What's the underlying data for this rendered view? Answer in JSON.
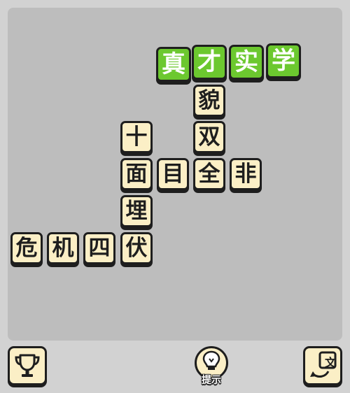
{
  "tiles": {
    "green": [
      "真",
      "才",
      "实",
      "学"
    ],
    "col_right": [
      "貌",
      "双"
    ],
    "row_mid": [
      "面",
      "目",
      "全",
      "非"
    ],
    "col_left": [
      "十",
      "埋"
    ],
    "row_bottom": [
      "危",
      "机",
      "四",
      "伏"
    ]
  },
  "buttons": {
    "hint_label": "提示",
    "translate_glyph": "文"
  },
  "colors": {
    "tile_bg": "#fbefc6",
    "green_tile": "#6cc82f",
    "board": "#bdbdbd"
  }
}
